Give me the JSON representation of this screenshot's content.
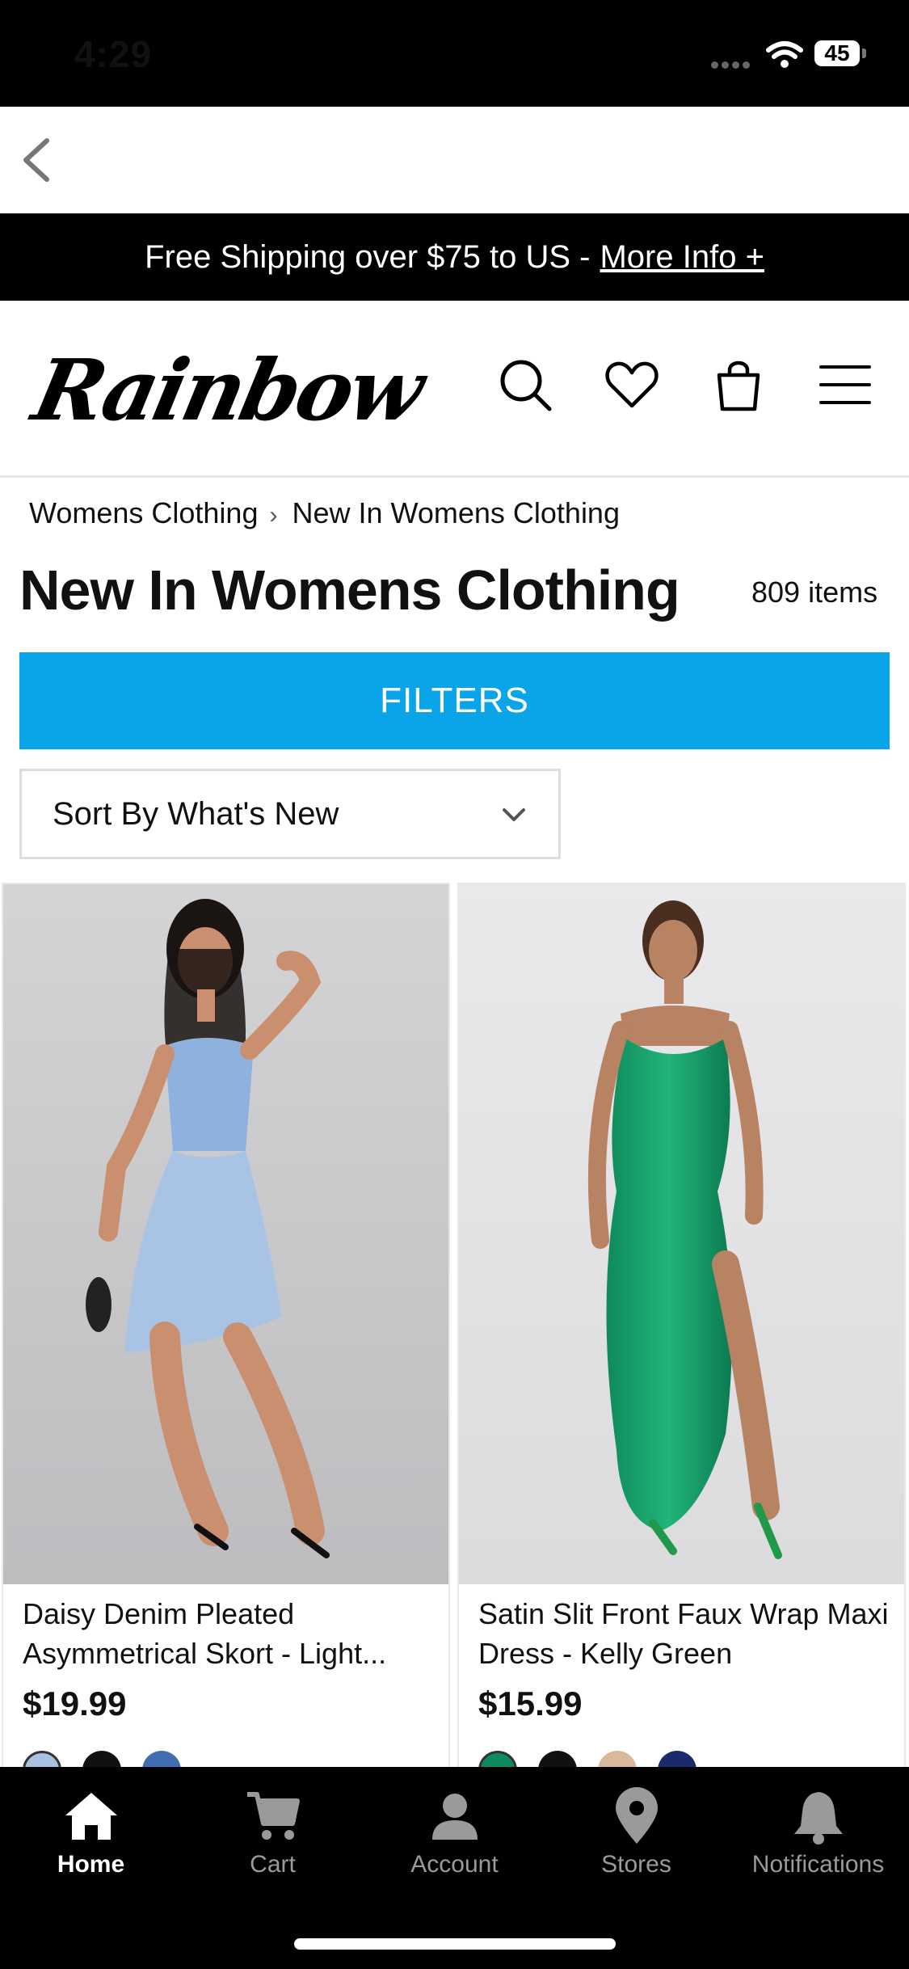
{
  "status": {
    "time": "4:29",
    "battery": "45"
  },
  "promo": {
    "text": "Free Shipping over $75 to US -",
    "link": "More Info +"
  },
  "brand": {
    "logo": "Rainbow"
  },
  "breadcrumb": {
    "items": [
      "Womens Clothing",
      "New In Womens Clothing"
    ],
    "separator": "›"
  },
  "page": {
    "title": "New In Womens Clothing",
    "count": "809 items"
  },
  "filters": {
    "label": "FILTERS"
  },
  "sort": {
    "label": "Sort By What's New"
  },
  "products": [
    {
      "name": "Daisy Denim Pleated Asymmetrical Skort - Light...",
      "price": "$19.99",
      "swatches": [
        "#a8c1e0",
        "#111111",
        "#3f6fb0"
      ]
    },
    {
      "name": "Satin Slit Front Faux Wrap Maxi Dress - Kelly Green",
      "price": "$15.99",
      "swatches": [
        "#0f8a5c",
        "#111111",
        "#d9b99a",
        "#1b2a6b"
      ]
    }
  ],
  "tabs": [
    {
      "label": "Home",
      "icon": "home-icon"
    },
    {
      "label": "Cart",
      "icon": "cart-icon"
    },
    {
      "label": "Account",
      "icon": "account-icon"
    },
    {
      "label": "Stores",
      "icon": "location-pin-icon"
    },
    {
      "label": "Notifications",
      "icon": "bell-icon"
    }
  ],
  "colors": {
    "accent": "#0aa5e8",
    "bar": "#000000"
  }
}
